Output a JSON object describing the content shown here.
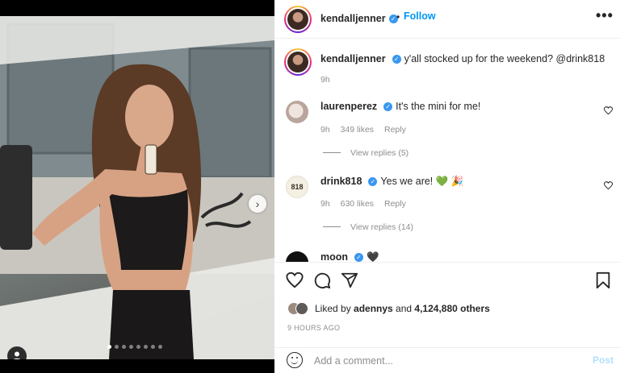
{
  "post": {
    "author": "kendalljenner",
    "follow_label": "Follow",
    "separator": "•",
    "more_label": "•••",
    "verified_glyph": "✓",
    "carousel": {
      "total": 8,
      "active": 0
    }
  },
  "comments": [
    {
      "username": "kendalljenner",
      "text": "y'all stocked up for the weekend? @drink818",
      "time": "9h",
      "likes": "",
      "reply": "",
      "view_replies": ""
    },
    {
      "username": "laurenperez",
      "text": "It's the mini for me!",
      "time": "9h",
      "likes": "349 likes",
      "reply": "Reply",
      "view_replies": "View replies (5)"
    },
    {
      "username": "drink818",
      "text": "Yes we are! 💚 🎉",
      "time": "9h",
      "likes": "630 likes",
      "reply": "Reply",
      "view_replies": "View replies (14)"
    },
    {
      "username": "moon",
      "text": "🖤",
      "time": "",
      "likes": "",
      "reply": "",
      "view_replies": ""
    }
  ],
  "drink818_avatar_text": "818",
  "actions": {
    "likes_prefix": "Liked by ",
    "likes_user": "adennys",
    "likes_mid": " and ",
    "likes_count": "4,124,880 others",
    "time_ago": "9 HOURS AGO",
    "comment_placeholder": "Add a comment...",
    "post_label": "Post"
  },
  "icons": {
    "heart": "heart-icon",
    "comment": "comment-icon",
    "share": "share-icon",
    "save": "bookmark-icon",
    "next": "chevron-right-icon",
    "emoji": "emoji-icon",
    "tags": "user-tag-icon"
  },
  "colors": {
    "accent": "#0095f6",
    "verified": "#3897f0",
    "muted": "#8e8e8e",
    "post_disabled": "#b2dffc"
  }
}
